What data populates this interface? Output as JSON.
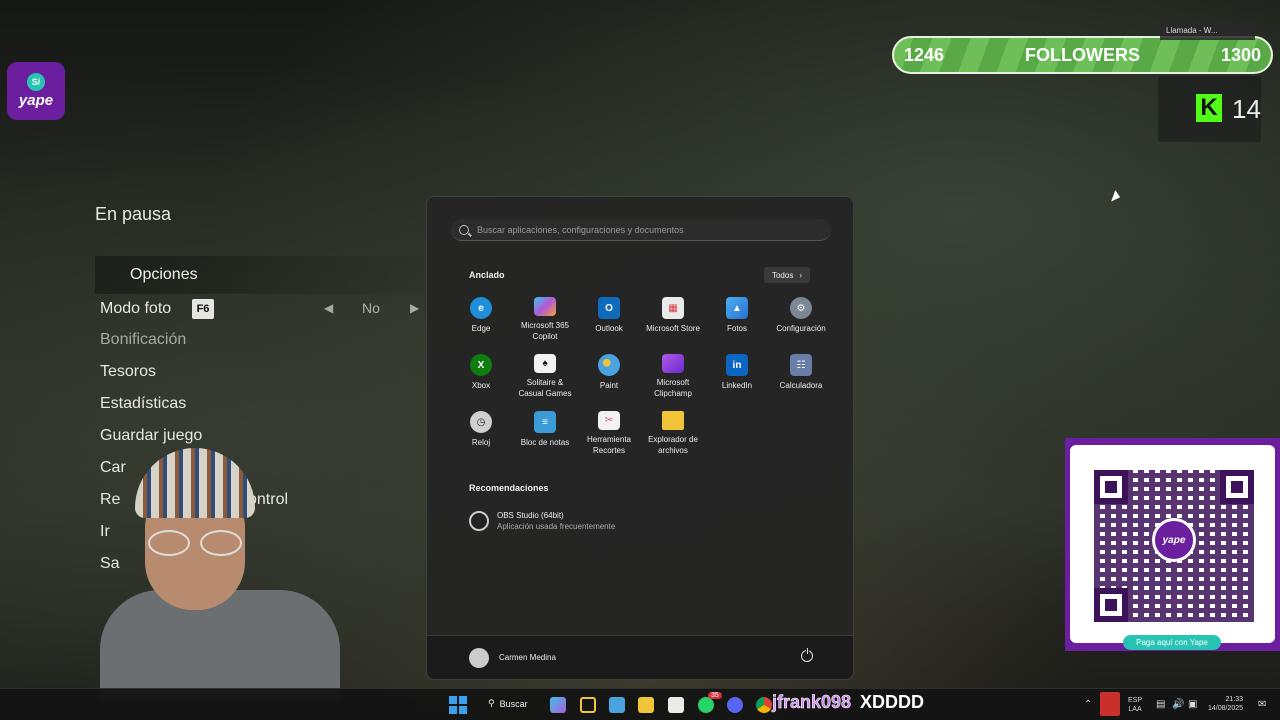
{
  "game_pause": {
    "title": "En pausa",
    "options_label": "Opciones",
    "rows": [
      "Modo foto",
      "Bonificación",
      "Tesoros",
      "Estadísticas",
      "Guardar juego",
      "Car",
      "Re",
      "control",
      "Ir",
      "Sa"
    ],
    "modo_foto_key": "F6",
    "modo_foto_value": "No"
  },
  "yape_logo": {
    "badge": "S/",
    "word": "yape"
  },
  "followers": {
    "current": "1246",
    "label": "FOLLOWERS",
    "goal": "1300"
  },
  "call_overlay": {
    "label": "Llamada - W..."
  },
  "kick": {
    "letter": "K",
    "count": "14"
  },
  "start_menu": {
    "search_placeholder": "Buscar aplicaciones, configuraciones y documentos",
    "pinned_title": "Anclado",
    "all_button": "Todos",
    "pinned_apps": [
      {
        "label": "Edge",
        "icon": "edge-icon",
        "color": "#1e8fd8"
      },
      {
        "label": "Microsoft 365\nCopilot",
        "icon": "copilot-icon",
        "color": "#7b5cd6"
      },
      {
        "label": "Outlook",
        "icon": "outlook-icon",
        "color": "#0f6cbd"
      },
      {
        "label": "Microsoft Store",
        "icon": "store-icon",
        "color": "#e8e8e8"
      },
      {
        "label": "Fotos",
        "icon": "photos-icon",
        "color": "#2f8fd8"
      },
      {
        "label": "Configuración",
        "icon": "gear-icon",
        "color": "#8a8a8a"
      },
      {
        "label": "Xbox",
        "icon": "xbox-icon",
        "color": "#107c10"
      },
      {
        "label": "Solitaire &\nCasual Games",
        "icon": "solitaire-icon",
        "color": "#f2f2f2"
      },
      {
        "label": "Paint",
        "icon": "paint-icon",
        "color": "#4aa3df"
      },
      {
        "label": "Microsoft\nClipchamp",
        "icon": "clipchamp-icon",
        "color": "#8a3ad6"
      },
      {
        "label": "LinkedIn",
        "icon": "linkedin-icon",
        "color": "#0a66c2"
      },
      {
        "label": "Calculadora",
        "icon": "calculator-icon",
        "color": "#6a7fa8"
      },
      {
        "label": "Reloj",
        "icon": "clock-icon",
        "color": "#cfcfcf"
      },
      {
        "label": "Bloc de notas",
        "icon": "notepad-icon",
        "color": "#3a9bd6"
      },
      {
        "label": "Herramienta\nRecortes",
        "icon": "snipping-icon",
        "color": "#e24a6a"
      },
      {
        "label": "Explorador de\narchivos",
        "icon": "folder-icon",
        "color": "#f2c43a"
      }
    ],
    "recommended_title": "Recomendaciones",
    "recommended": [
      {
        "name": "OBS Studio (64bit)",
        "sub": "Aplicación usada frecuentemente",
        "icon": "obs-icon"
      }
    ],
    "user_name": "Carmen Medina"
  },
  "qr_panel": {
    "center_text": "yape",
    "caption": "Paga aquí con Yape"
  },
  "taskbar": {
    "search_label": "Buscar",
    "whatsapp_badge": "35",
    "overlay_user": "jfrank098",
    "overlay_message": "XDDDD",
    "language_top": "ESP",
    "language_bottom": "LAA",
    "time": "21:33",
    "date": "14/08/2025"
  }
}
